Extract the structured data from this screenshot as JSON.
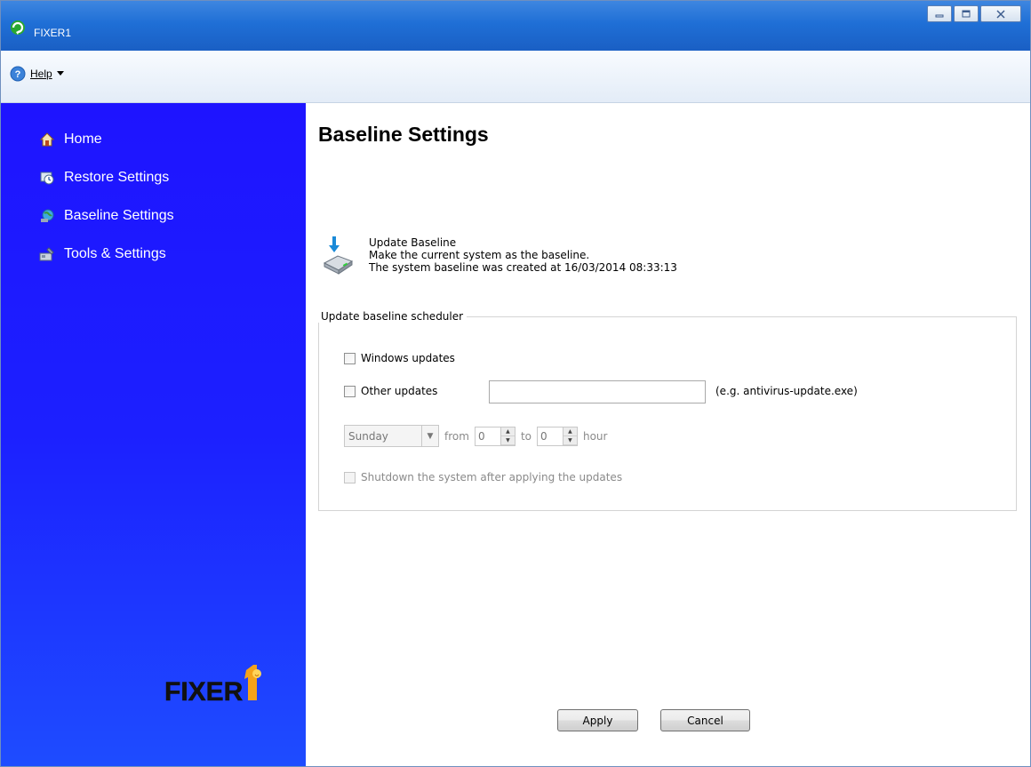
{
  "window": {
    "title": "FIXER1",
    "controls": [
      "minimize",
      "maximize",
      "close"
    ]
  },
  "menubar": {
    "help_label": "Help"
  },
  "sidebar": {
    "items": [
      {
        "label": "Home",
        "icon": "home-icon"
      },
      {
        "label": "Restore Settings",
        "icon": "restore-icon"
      },
      {
        "label": "Baseline Settings",
        "icon": "baseline-icon"
      },
      {
        "label": "Tools & Settings",
        "icon": "tools-icon"
      }
    ],
    "logo_text": "FIXER",
    "colors": {
      "background": "#1e14ff",
      "text": "#ffffff"
    }
  },
  "main": {
    "title": "Baseline Settings",
    "update_baseline": {
      "link": "Update Baseline",
      "description": "Make the current system as the baseline.",
      "created_text": "The system baseline was created at 16/03/2014 08:33:13"
    },
    "scheduler": {
      "legend": "Update baseline scheduler",
      "windows_updates_label": "Windows updates",
      "windows_updates_checked": false,
      "other_updates_label": "Other updates",
      "other_updates_checked": false,
      "other_updates_value": "",
      "other_updates_hint": "(e.g. antivirus-update.exe)",
      "day_value": "Sunday",
      "from_label": "from",
      "from_value": "0",
      "to_label": "to",
      "to_value": "0",
      "hour_label": "hour",
      "shutdown_label": "Shutdown the system after applying the updates",
      "shutdown_checked": false
    },
    "buttons": {
      "apply": "Apply",
      "cancel": "Cancel"
    }
  }
}
